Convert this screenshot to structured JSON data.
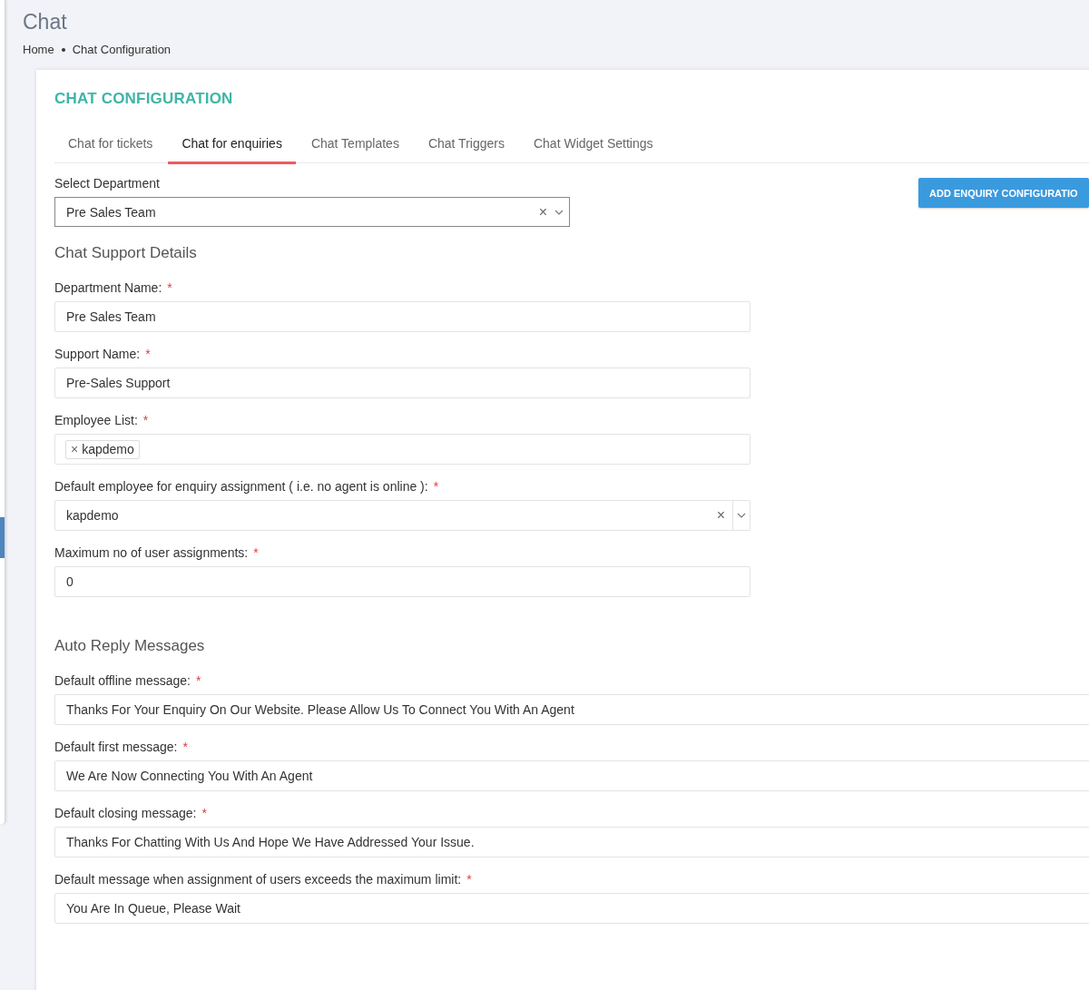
{
  "page_title": "Chat",
  "breadcrumb": [
    "Home",
    "Chat Configuration"
  ],
  "card_title": "CHAT CONFIGURATION",
  "tabs": [
    {
      "label": "Chat for tickets",
      "selected": false
    },
    {
      "label": "Chat for enquiries",
      "selected": true
    },
    {
      "label": "Chat Templates",
      "selected": false
    },
    {
      "label": "Chat Triggers",
      "selected": false
    },
    {
      "label": "Chat Widget Settings",
      "selected": false
    }
  ],
  "department_select": {
    "label": "Select Department",
    "value": "Pre Sales Team",
    "clear_icon": "×"
  },
  "add_button": "ADD ENQUIRY CONFIGURATIO",
  "sections": [
    {
      "title": "Chat Support Details",
      "fields": [
        {
          "label": "Department Name:",
          "required_mark": "*",
          "kind": "text",
          "value": "Pre Sales Team"
        },
        {
          "label": "Support Name:",
          "required_mark": "*",
          "kind": "text",
          "value": "Pre-Sales Support"
        },
        {
          "label": "Employee List:",
          "required_mark": "*",
          "kind": "tags",
          "tags": [
            {
              "remove_icon": "×",
              "text": "kapdemo"
            }
          ]
        },
        {
          "label": "Default employee for enquiry assignment ( i.e. no agent is online ):",
          "required_mark": "*",
          "kind": "select",
          "value": "kapdemo",
          "clear_icon": "×"
        },
        {
          "label": "Maximum no of user assignments:",
          "required_mark": "*",
          "kind": "text",
          "value": "0"
        }
      ]
    },
    {
      "title": "Auto Reply Messages",
      "fields": [
        {
          "label": "Default offline message:",
          "required_mark": "*",
          "kind": "text",
          "value": "Thanks For Your Enquiry On Our Website. Please Allow Us To Connect You With An Agent"
        },
        {
          "label": "Default first message:",
          "required_mark": "*",
          "kind": "text",
          "value": "We Are Now Connecting You With An Agent"
        },
        {
          "label": "Default closing message:",
          "required_mark": "*",
          "kind": "text",
          "value": "Thanks For Chatting With Us And Hope We Have Addressed Your Issue."
        },
        {
          "label": "Default message when assignment of users exceeds the maximum limit:",
          "required_mark": "*",
          "kind": "text",
          "value": "You Are In Queue, Please Wait"
        }
      ]
    }
  ]
}
